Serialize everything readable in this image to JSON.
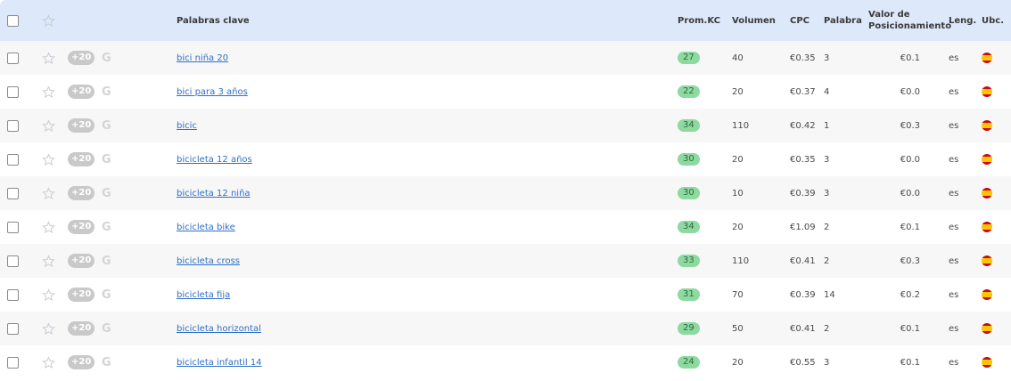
{
  "header": {
    "keywords": "Palabras clave",
    "prom_kc": "Prom.KC",
    "volumen": "Volumen",
    "cpc": "CPC",
    "palabra": "Palabra",
    "valor_line1": "Valor de",
    "valor_line2": "Posicionamiento",
    "leng": "Leng.",
    "ubc": "Ubc."
  },
  "plus_label": "+20",
  "google_letter": "G",
  "colors": {
    "header_bg": "#dde8fb",
    "link": "#2f6fc6",
    "kc_badge": "#8dd9a0"
  },
  "rows": [
    {
      "keyword": "bici niña 20",
      "kc": "27",
      "volume": "40",
      "cpc": "€0.35",
      "words": "3",
      "value": "€0.1",
      "lang": "es",
      "flag": "spain-flag"
    },
    {
      "keyword": "bici para 3 años",
      "kc": "22",
      "volume": "20",
      "cpc": "€0.37",
      "words": "4",
      "value": "€0.0",
      "lang": "es",
      "flag": "spain-flag"
    },
    {
      "keyword": "bicic",
      "kc": "34",
      "volume": "110",
      "cpc": "€0.42",
      "words": "1",
      "value": "€0.3",
      "lang": "es",
      "flag": "spain-flag"
    },
    {
      "keyword": "bicicleta 12 años",
      "kc": "30",
      "volume": "20",
      "cpc": "€0.35",
      "words": "3",
      "value": "€0.0",
      "lang": "es",
      "flag": "spain-flag"
    },
    {
      "keyword": "bicicleta 12 niña",
      "kc": "30",
      "volume": "10",
      "cpc": "€0.39",
      "words": "3",
      "value": "€0.0",
      "lang": "es",
      "flag": "spain-flag"
    },
    {
      "keyword": "bicicleta bike",
      "kc": "34",
      "volume": "20",
      "cpc": "€1.09",
      "words": "2",
      "value": "€0.1",
      "lang": "es",
      "flag": "spain-flag"
    },
    {
      "keyword": "bicicleta cross",
      "kc": "33",
      "volume": "110",
      "cpc": "€0.41",
      "words": "2",
      "value": "€0.3",
      "lang": "es",
      "flag": "spain-flag"
    },
    {
      "keyword": "bicicleta fija",
      "kc": "31",
      "volume": "70",
      "cpc": "€0.39",
      "words": "14",
      "value": "€0.2",
      "lang": "es",
      "flag": "spain-flag"
    },
    {
      "keyword": "bicicleta horizontal",
      "kc": "29",
      "volume": "50",
      "cpc": "€0.41",
      "words": "2",
      "value": "€0.1",
      "lang": "es",
      "flag": "spain-flag"
    },
    {
      "keyword": "bicicleta infantil 14",
      "kc": "24",
      "volume": "20",
      "cpc": "€0.55",
      "words": "3",
      "value": "€0.1",
      "lang": "es",
      "flag": "spain-flag"
    }
  ]
}
